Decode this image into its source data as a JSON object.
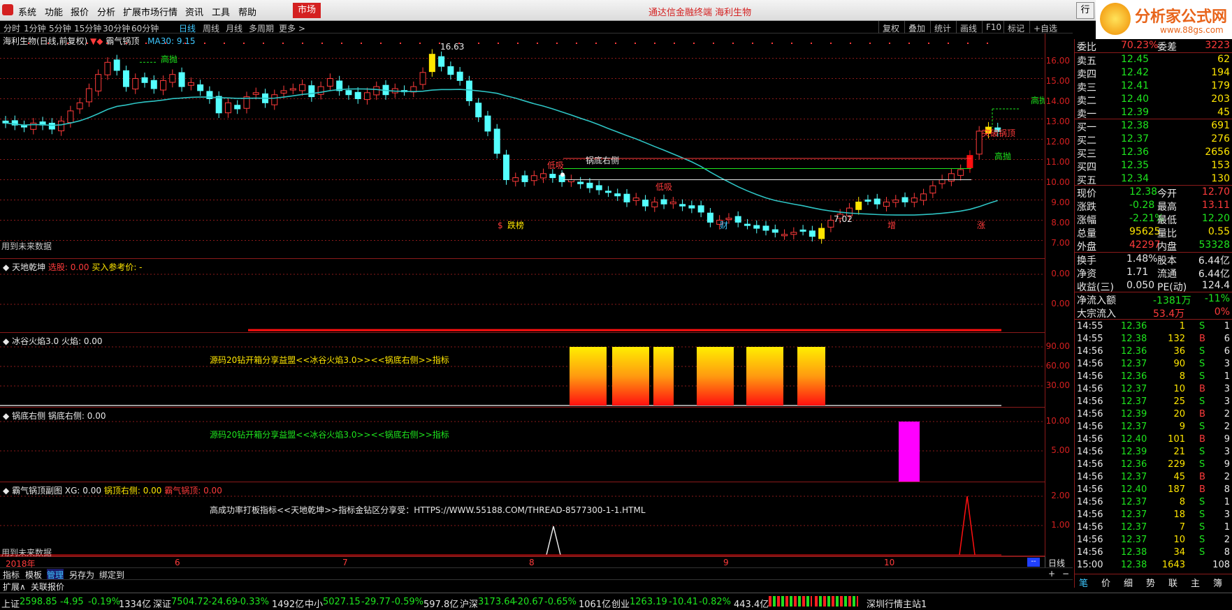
{
  "menu": {
    "items": [
      "系统",
      "功能",
      "报价",
      "分析",
      "扩展市场行情",
      "资讯",
      "工具",
      "帮助"
    ],
    "market": "市场",
    "center_title": "通达信金融终端  海利生物",
    "window_btn": "行"
  },
  "brand": {
    "name": "分析家公式网",
    "url": "www.88gs.com"
  },
  "periods": {
    "items": [
      "分时",
      "1分钟",
      "5分钟",
      "15分钟",
      "30分钟",
      "60分钟",
      "日线",
      "周线",
      "月线",
      "多周期",
      "更多 >"
    ],
    "active_index": 6
  },
  "toolbar": [
    "复权",
    "叠加",
    "统计",
    "画线",
    "F10",
    "标记",
    "+自选"
  ],
  "main_chart": {
    "title": "海利生物(日线,前复权)",
    "indicator_name": "霸气锅顶",
    "ma_label": "MA30: 9.15",
    "future_note": "用到未来数据",
    "annotations": {
      "high_label": "16.63",
      "low_label": "7.02",
      "gao_pao": "高抛",
      "di_xi": "低吸",
      "guo_di_you_ce": "锅底右侧",
      "tu_po_guo_ding": "突破锅顶"
    },
    "markers": [
      "$",
      "跌榜",
      "财",
      "增",
      "涨"
    ],
    "ticks": [
      "16.00",
      "15.00",
      "14.00",
      "13.00",
      "12.00",
      "11.00",
      "10.00",
      "9.00",
      "8.00",
      "7.00"
    ]
  },
  "pane1": {
    "name": "天地乾坤",
    "label_a": "选股: 0.00",
    "label_b": "买入参考价: -",
    "ticks": [
      "0.00",
      "0.00"
    ]
  },
  "pane2": {
    "name": "冰谷火焰3.0",
    "label": "火焰: 0.00",
    "note": "源码20钻开箱分享益盟<<冰谷火焰3.0>><<锅底右侧>>指标",
    "ticks": [
      "90.00",
      "60.00",
      "30.00"
    ]
  },
  "pane3": {
    "name": "锅底右侧",
    "label": "锅底右侧: 0.00",
    "note": "源码20钻开箱分享益盟<<冰谷火焰3.0>><<锅底右侧>>指标",
    "ticks": [
      "10.00",
      "5.00"
    ]
  },
  "pane4": {
    "name": "霸气锅顶副图",
    "label_a": "XG: 0.00",
    "label_b": "锅顶右侧: 0.00",
    "label_c": "霸气锅顶: 0.00",
    "note": "高成功率打板指标<<天地乾坤>>指标金钻区分享受：HTTPS://WWW.55188.COM/THREAD-8577300-1-1.HTML",
    "future_note": "用到未来数据",
    "ticks": [
      "2.00",
      "1.00"
    ]
  },
  "time_axis": {
    "labels": [
      "2018年",
      "6",
      "7",
      "8",
      "9",
      "10"
    ],
    "period": "日线"
  },
  "bottom_tabs": [
    "指标",
    "模板",
    "管理",
    "另存为",
    "绑定到"
  ],
  "bottom_tabs2": [
    "扩展∧",
    "关联报价"
  ],
  "quote": {
    "wei_bi": {
      "label": "委比",
      "value": "70.23%",
      "label2": "委差",
      "value2": "3223"
    },
    "sells": [
      {
        "label": "卖五",
        "price": "12.45",
        "vol": "62"
      },
      {
        "label": "卖四",
        "price": "12.42",
        "vol": "194"
      },
      {
        "label": "卖三",
        "price": "12.41",
        "vol": "179"
      },
      {
        "label": "卖二",
        "price": "12.40",
        "vol": "203"
      },
      {
        "label": "卖一",
        "price": "12.39",
        "vol": "45"
      }
    ],
    "buys": [
      {
        "label": "买一",
        "price": "12.38",
        "vol": "691"
      },
      {
        "label": "买二",
        "price": "12.37",
        "vol": "276"
      },
      {
        "label": "买三",
        "price": "12.36",
        "vol": "2656"
      },
      {
        "label": "买四",
        "price": "12.35",
        "vol": "153"
      },
      {
        "label": "买五",
        "price": "12.34",
        "vol": "130"
      }
    ],
    "stats": [
      {
        "l1": "现价",
        "v1": "12.38",
        "c1": "green",
        "l2": "今开",
        "v2": "12.70",
        "c2": "red"
      },
      {
        "l1": "涨跌",
        "v1": "-0.28",
        "c1": "green",
        "l2": "最高",
        "v2": "13.11",
        "c2": "red"
      },
      {
        "l1": "涨幅",
        "v1": "-2.21%",
        "c1": "green",
        "l2": "最低",
        "v2": "12.20",
        "c2": "green"
      },
      {
        "l1": "总量",
        "v1": "95625",
        "c1": "yellow",
        "l2": "量比",
        "v2": "0.55",
        "c2": "yellow"
      },
      {
        "l1": "外盘",
        "v1": "42297",
        "c1": "red",
        "l2": "内盘",
        "v2": "53328",
        "c2": "green"
      }
    ],
    "stats2": [
      {
        "l1": "换手",
        "v1": "1.48%",
        "l2": "股本",
        "v2": "6.44亿"
      },
      {
        "l1": "净资",
        "v1": "1.71",
        "l2": "流通",
        "v2": "6.44亿"
      },
      {
        "l1": "收益(三)",
        "v1": "0.050",
        "l2": "PE(动)",
        "v2": "124.4"
      }
    ],
    "flow": [
      {
        "label": "净流入额",
        "v1": "-1381万",
        "v2": "-11%",
        "c": "green"
      },
      {
        "label": "大宗流入",
        "v1": "53.4万",
        "v2": "0%",
        "c": "red"
      }
    ]
  },
  "ticks_list": [
    {
      "t": "14:55",
      "p": "12.36",
      "v": "1",
      "s": "S",
      "n": "1"
    },
    {
      "t": "14:55",
      "p": "12.38",
      "v": "132",
      "s": "B",
      "n": "6"
    },
    {
      "t": "14:56",
      "p": "12.36",
      "v": "36",
      "s": "S",
      "n": "6"
    },
    {
      "t": "14:56",
      "p": "12.37",
      "v": "90",
      "s": "S",
      "n": "3"
    },
    {
      "t": "14:56",
      "p": "12.36",
      "v": "8",
      "s": "S",
      "n": "1"
    },
    {
      "t": "14:56",
      "p": "12.37",
      "v": "10",
      "s": "B",
      "n": "3"
    },
    {
      "t": "14:56",
      "p": "12.37",
      "v": "25",
      "s": "S",
      "n": "3"
    },
    {
      "t": "14:56",
      "p": "12.39",
      "v": "20",
      "s": "B",
      "n": "2"
    },
    {
      "t": "14:56",
      "p": "12.37",
      "v": "9",
      "s": "S",
      "n": "2"
    },
    {
      "t": "14:56",
      "p": "12.40",
      "v": "101",
      "s": "B",
      "n": "9"
    },
    {
      "t": "14:56",
      "p": "12.39",
      "v": "21",
      "s": "S",
      "n": "3"
    },
    {
      "t": "14:56",
      "p": "12.36",
      "v": "229",
      "s": "S",
      "n": "9"
    },
    {
      "t": "14:56",
      "p": "12.37",
      "v": "45",
      "s": "B",
      "n": "2"
    },
    {
      "t": "14:56",
      "p": "12.40",
      "v": "187",
      "s": "B",
      "n": "8"
    },
    {
      "t": "14:56",
      "p": "12.37",
      "v": "8",
      "s": "S",
      "n": "1"
    },
    {
      "t": "14:56",
      "p": "12.37",
      "v": "18",
      "s": "S",
      "n": "3"
    },
    {
      "t": "14:56",
      "p": "12.37",
      "v": "7",
      "s": "S",
      "n": "1"
    },
    {
      "t": "14:56",
      "p": "12.37",
      "v": "10",
      "s": "S",
      "n": "2"
    },
    {
      "t": "14:56",
      "p": "12.38",
      "v": "34",
      "s": "S",
      "n": "8"
    },
    {
      "t": "15:00",
      "p": "12.38",
      "v": "1643",
      "s": "",
      "n": "108"
    }
  ],
  "rp_tabs": [
    "笔",
    "价",
    "细",
    "势",
    "联",
    "主",
    "簿"
  ],
  "statusbar": {
    "sh": {
      "name": "上证",
      "v": "2598.85",
      "c": "-4.95",
      "p": "-0.19%",
      "amt": "1334亿"
    },
    "sz": {
      "name": "深证",
      "v": "7504.72",
      "c": "-24.69",
      "p": "-0.33%",
      "amt": "1492亿"
    },
    "zx": {
      "name": "中小",
      "v": "5027.15",
      "c": "-29.77",
      "p": "-0.59%",
      "amt": "597.8亿"
    },
    "hs": {
      "name": "沪深",
      "v": "3173.64",
      "c": "-20.67",
      "p": "-0.65%",
      "amt": "1061亿"
    },
    "cy": {
      "name": "创业",
      "v": "1263.19",
      "c": "-10.41",
      "p": "-0.82%",
      "amt": "443.4亿"
    },
    "server": "深圳行情主站1"
  }
}
